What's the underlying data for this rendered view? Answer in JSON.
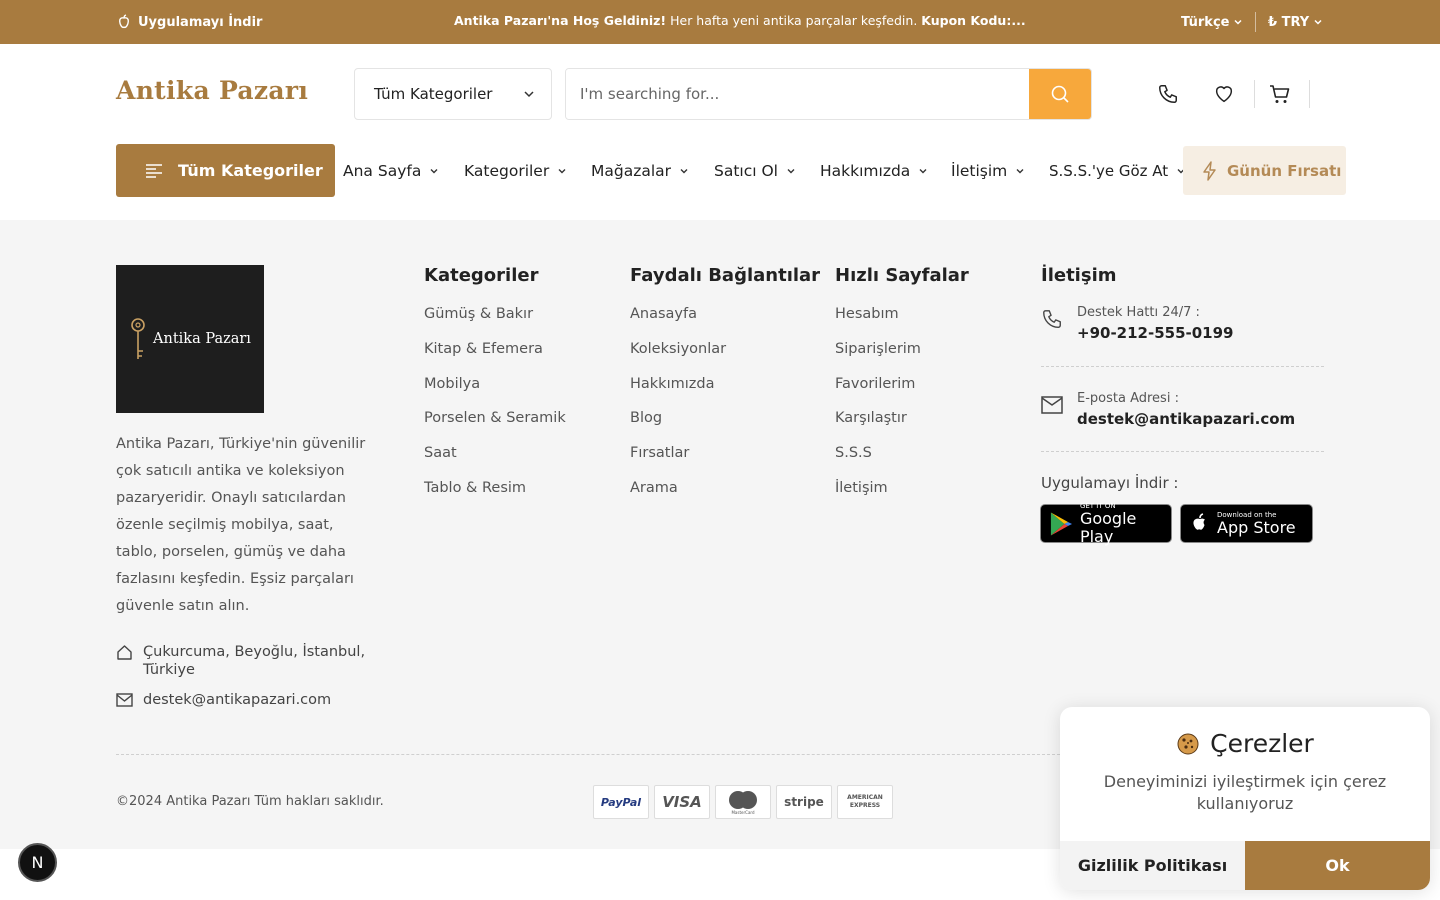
{
  "topbar": {
    "app_label": "Uygulamayı İndir",
    "promo_bold": "Antika Pazarı'na Hoş Geldiniz!",
    "promo_text": " Her hafta yeni antika parçalar keşfedin. ",
    "promo_coupon": "Kupon Kodu:...",
    "language": "Türkçe",
    "currency": "₺ TRY"
  },
  "header": {
    "logo": "Antika Pazarı",
    "category_select": "Tüm Kategoriler",
    "search_placeholder": "I'm searching for..."
  },
  "nav": {
    "all_categories": "Tüm Kategoriler",
    "items": [
      "Ana Sayfa",
      "Kategoriler",
      "Mağazalar",
      "Satıcı Ol",
      "Hakkımızda",
      "İletişim",
      "S.S.S.'ye Göz At"
    ],
    "deal": "Günün Fırsatı"
  },
  "footer": {
    "logo_text": "Antika Pazarı",
    "description": "Antika Pazarı, Türkiye'nin güvenilir çok satıcılı antika ve koleksiyon pazaryeridir. Onaylı satıcılardan özenle seçilmiş mobilya, saat, tablo, porselen, gümüş ve daha fazlasını keşfedin. Eşsiz parçaları güvenle satın alın.",
    "address": "Çukurcuma, Beyoğlu, İstanbul, Türkiye",
    "email": "destek@antikapazari.com",
    "columns": [
      {
        "title": "Kategoriler",
        "links": [
          "Gümüş & Bakır",
          "Kitap & Efemera",
          "Mobilya",
          "Porselen & Seramik",
          "Saat",
          "Tablo & Resim"
        ]
      },
      {
        "title": "Faydalı Bağlantılar",
        "links": [
          "Anasayfa",
          "Koleksiyonlar",
          "Hakkımızda",
          "Blog",
          "Fırsatlar",
          "Arama"
        ]
      },
      {
        "title": "Hızlı Sayfalar",
        "links": [
          "Hesabım",
          "Siparişlerim",
          "Favorilerim",
          "Karşılaştır",
          "S.S.S",
          "İletişim"
        ]
      }
    ],
    "contact": {
      "title": "İletişim",
      "phone_label": "Destek Hattı 24/7 :",
      "phone": "+90-212-555-0199",
      "email_label": "E-posta Adresi :",
      "email": "destek@antikapazari.com",
      "app_label": "Uygulamayı İndir :",
      "google_small": "GET IT ON",
      "google_big": "Google Play",
      "apple_small": "Download on the",
      "apple_big": "App Store"
    },
    "copyright": "©2024 Antika Pazarı Tüm hakları saklıdır.",
    "payments": [
      "PayPal",
      "VISA",
      "MasterCard",
      "stripe",
      "AMERICAN EXPRESS"
    ]
  },
  "badge": "N",
  "cookie": {
    "title": "Çerezler",
    "message": "Deneyiminizi iyileştirmek için çerez kullanıyoruz",
    "privacy": "Gizlilik Politikası",
    "ok": "Ok"
  },
  "colors": {
    "brand": "#a87b3f",
    "search_button": "#f7a83c",
    "deal_bg": "#f6eee3"
  }
}
